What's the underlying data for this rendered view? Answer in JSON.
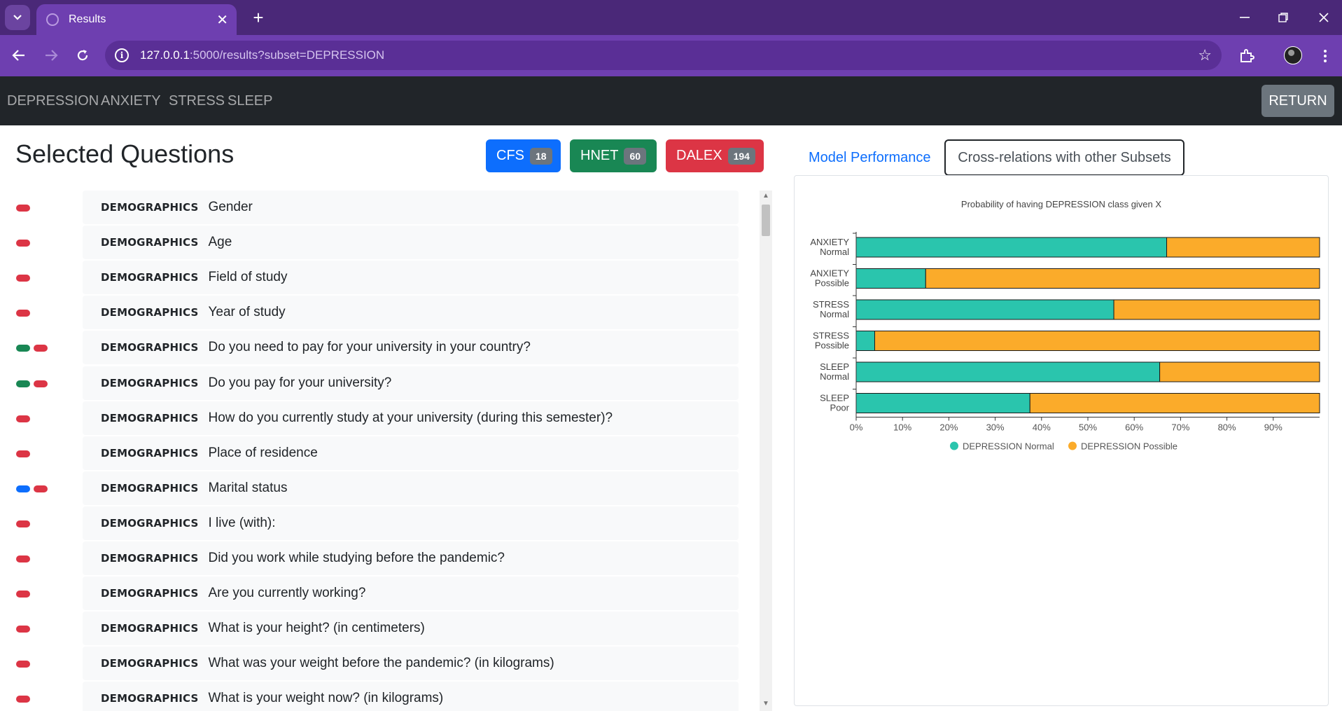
{
  "browser": {
    "tab_title": "Results",
    "url_host": "127.0.0.1",
    "url_path": ":5000/results?subset=DEPRESSION"
  },
  "navbar": {
    "links": [
      "DEPRESSION",
      "ANXIETY",
      "STRESS",
      "SLEEP"
    ],
    "return_label": "RETURN"
  },
  "left": {
    "title": "Selected Questions",
    "badges": [
      {
        "label": "CFS",
        "count": "18",
        "color": "#0d6efd"
      },
      {
        "label": "HNET",
        "count": "60",
        "color": "#198754"
      },
      {
        "label": "DALEX",
        "count": "194",
        "color": "#dc3545"
      }
    ],
    "questions": [
      {
        "category": "DEMOGRAPHICS",
        "text": "Gender",
        "methods": [
          "red"
        ]
      },
      {
        "category": "DEMOGRAPHICS",
        "text": "Age",
        "methods": [
          "red"
        ]
      },
      {
        "category": "DEMOGRAPHICS",
        "text": "Field of study",
        "methods": [
          "red"
        ]
      },
      {
        "category": "DEMOGRAPHICS",
        "text": "Year of study",
        "methods": [
          "red"
        ]
      },
      {
        "category": "DEMOGRAPHICS",
        "text": "Do you need to pay for your university in your country?",
        "methods": [
          "green",
          "red"
        ]
      },
      {
        "category": "DEMOGRAPHICS",
        "text": "Do you pay for your university?",
        "methods": [
          "green",
          "red"
        ]
      },
      {
        "category": "DEMOGRAPHICS",
        "text": "How do you currently study at your university (during this semester)?",
        "methods": [
          "red"
        ]
      },
      {
        "category": "DEMOGRAPHICS",
        "text": "Place of residence",
        "methods": [
          "red"
        ]
      },
      {
        "category": "DEMOGRAPHICS",
        "text": "Marital status",
        "methods": [
          "blue",
          "red"
        ]
      },
      {
        "category": "DEMOGRAPHICS",
        "text": "I live (with):",
        "methods": [
          "red"
        ]
      },
      {
        "category": "DEMOGRAPHICS",
        "text": "Did you work while studying before the pandemic?",
        "methods": [
          "red"
        ]
      },
      {
        "category": "DEMOGRAPHICS",
        "text": "Are you currently working?",
        "methods": [
          "red"
        ]
      },
      {
        "category": "DEMOGRAPHICS",
        "text": "What is your height? (in centimeters)",
        "methods": [
          "red"
        ]
      },
      {
        "category": "DEMOGRAPHICS",
        "text": "What was your weight before the pandemic? (in kilograms)",
        "methods": [
          "red"
        ]
      },
      {
        "category": "DEMOGRAPHICS",
        "text": "What is your weight now? (in kilograms)",
        "methods": [
          "red"
        ]
      }
    ]
  },
  "right": {
    "tabs": [
      "Model Performance",
      "Cross-relations with other Subsets"
    ],
    "active_tab": "Cross-relations with other Subsets"
  },
  "chart_data": {
    "type": "bar",
    "orientation": "horizontal",
    "stacked": true,
    "title": "Probability of having DEPRESSION class given X",
    "categories": [
      [
        "ANXIETY",
        "Normal"
      ],
      [
        "ANXIETY",
        "Possible"
      ],
      [
        "STRESS",
        "Normal"
      ],
      [
        "STRESS",
        "Possible"
      ],
      [
        "SLEEP",
        "Normal"
      ],
      [
        "SLEEP",
        "Poor"
      ]
    ],
    "series": [
      {
        "name": "DEPRESSION Normal",
        "color": "#2ac5ad",
        "values": [
          0.67,
          0.15,
          0.556,
          0.04,
          0.655,
          0.375
        ]
      },
      {
        "name": "DEPRESSION Possible",
        "color": "#fbab2a",
        "values": [
          0.33,
          0.85,
          0.444,
          0.96,
          0.345,
          0.625
        ]
      }
    ],
    "x_ticks": [
      "0%",
      "10%",
      "20%",
      "30%",
      "40%",
      "50%",
      "60%",
      "70%",
      "80%",
      "90%"
    ],
    "xlim": [
      0,
      1
    ],
    "legend_position": "bottom",
    "grid": false
  }
}
